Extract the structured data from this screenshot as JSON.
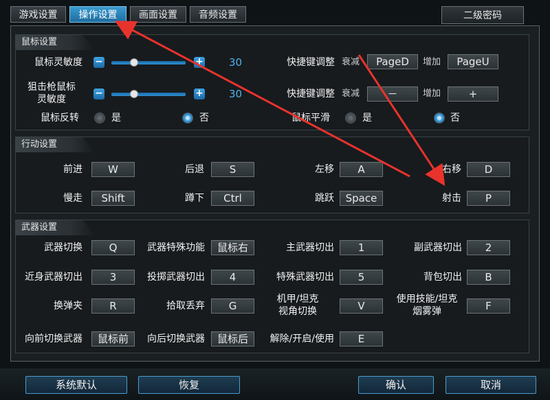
{
  "tabs": [
    "游戏设置",
    "操作设置",
    "画面设置",
    "音频设置"
  ],
  "second_password": "二级密码",
  "mouse": {
    "title": "鼠标设置",
    "sensitivity_label": "鼠标灵敏度",
    "sensitivity_value": "30",
    "sniper_label_1": "狙击枪鼠标",
    "sniper_label_2": "灵敏度",
    "sniper_value": "30",
    "invert_label": "鼠标反转",
    "yes": "是",
    "no": "否",
    "smooth_label": "鼠标平滑",
    "hotkey_label": "快捷键调整",
    "decrease": "衰减",
    "increase": "增加",
    "hotkey1_dec": "PageD",
    "hotkey1_inc": "PageU",
    "hotkey2_dec": "－",
    "hotkey2_inc": "+",
    "invert_selected": "否",
    "smooth_selected": "否"
  },
  "movement": {
    "title": "行动设置",
    "items": [
      {
        "label": "前进",
        "key": "W"
      },
      {
        "label": "后退",
        "key": "S"
      },
      {
        "label": "左移",
        "key": "A"
      },
      {
        "label": "右移",
        "key": "D"
      },
      {
        "label": "慢走",
        "key": "Shift"
      },
      {
        "label": "蹲下",
        "key": "Ctrl"
      },
      {
        "label": "跳跃",
        "key": "Space"
      },
      {
        "label": "射击",
        "key": "P"
      }
    ]
  },
  "weapon": {
    "title": "武器设置",
    "items": [
      {
        "label": "武器切换",
        "key": "Q"
      },
      {
        "label": "武器特殊功能",
        "key": "鼠标右"
      },
      {
        "label": "主武器切出",
        "key": "1"
      },
      {
        "label": "副武器切出",
        "key": "2"
      },
      {
        "label": "近身武器切出",
        "key": "3"
      },
      {
        "label": "投掷武器切出",
        "key": "4"
      },
      {
        "label": "特殊武器切出",
        "key": "5"
      },
      {
        "label": "背包切出",
        "key": "B"
      },
      {
        "label": "换弹夹",
        "key": "R"
      },
      {
        "label": "拾取丢弃",
        "key": "G"
      },
      {
        "label": "机甲/坦克",
        "label2": "视角切换",
        "key": "V"
      },
      {
        "label": "使用技能/坦克",
        "label2": "烟雾弹",
        "key": "F"
      },
      {
        "label": "向前切换武器",
        "key": "鼠标前"
      },
      {
        "label": "向后切换武器",
        "key": "鼠标后"
      },
      {
        "label": "解除/开启/使用",
        "key": "E"
      }
    ]
  },
  "footer": {
    "default": "系统默认",
    "restore": "恢复",
    "confirm": "确认",
    "cancel": "取消"
  },
  "colors": {
    "accent": "#3a9bd0",
    "arrow": "#e8332c"
  }
}
